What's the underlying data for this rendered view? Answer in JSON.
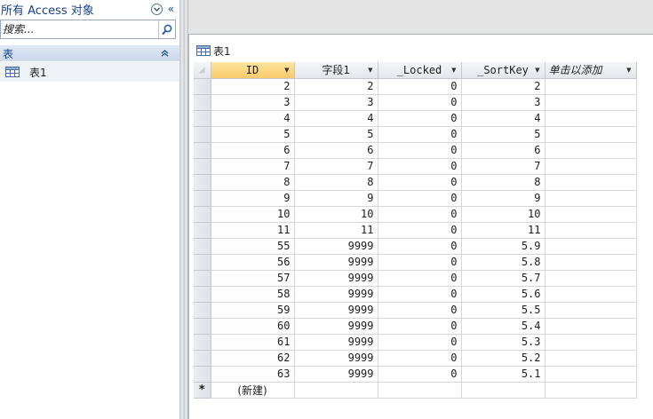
{
  "nav": {
    "title": "所有 Access 对象",
    "shutter_glyph": "«",
    "search_placeholder": "搜索...",
    "group_label": "表",
    "group_toggle_glyph": "⌃",
    "items": [
      {
        "label": "表1",
        "icon": "table-icon"
      }
    ]
  },
  "document": {
    "tab_label": "表1",
    "tab_icon": "table-icon"
  },
  "datasheet": {
    "columns": [
      {
        "label": "ID",
        "align": "right",
        "selected": true
      },
      {
        "label": "字段1",
        "align": "right",
        "selected": false
      },
      {
        "label": "_Locked",
        "align": "right",
        "selected": false
      },
      {
        "label": "_SortKey",
        "align": "right",
        "selected": false
      },
      {
        "label": "单击以添加",
        "align": "left",
        "selected": false
      }
    ],
    "rows": [
      [
        "2",
        "2",
        "0",
        "2",
        ""
      ],
      [
        "3",
        "3",
        "0",
        "3",
        ""
      ],
      [
        "4",
        "4",
        "0",
        "4",
        ""
      ],
      [
        "5",
        "5",
        "0",
        "5",
        ""
      ],
      [
        "6",
        "6",
        "0",
        "6",
        ""
      ],
      [
        "7",
        "7",
        "0",
        "7",
        ""
      ],
      [
        "8",
        "8",
        "0",
        "8",
        ""
      ],
      [
        "9",
        "9",
        "0",
        "9",
        ""
      ],
      [
        "10",
        "10",
        "0",
        "10",
        ""
      ],
      [
        "11",
        "11",
        "0",
        "11",
        ""
      ],
      [
        "55",
        "9999",
        "0",
        "5.9",
        ""
      ],
      [
        "56",
        "9999",
        "0",
        "5.8",
        ""
      ],
      [
        "57",
        "9999",
        "0",
        "5.7",
        ""
      ],
      [
        "58",
        "9999",
        "0",
        "5.6",
        ""
      ],
      [
        "59",
        "9999",
        "0",
        "5.5",
        ""
      ],
      [
        "60",
        "9999",
        "0",
        "5.4",
        ""
      ],
      [
        "61",
        "9999",
        "0",
        "5.3",
        ""
      ],
      [
        "62",
        "9999",
        "0",
        "5.2",
        ""
      ],
      [
        "63",
        "9999",
        "0",
        "5.1",
        ""
      ]
    ],
    "new_row_marker": "*",
    "new_row_text": "(新建)",
    "dropdown_glyph": "▼"
  },
  "colors": {
    "nav_title": "#15428b",
    "selected_header": "#f9c96a",
    "gridline": "#d7d7d7"
  }
}
